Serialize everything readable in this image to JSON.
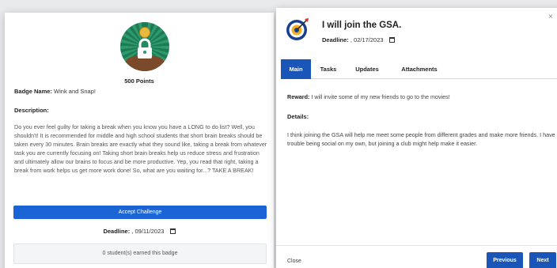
{
  "badge": {
    "points": "500 Points",
    "name_label": "Badge Name:",
    "name_value": "Wink and Snap!",
    "description_label": "Description:",
    "description": "Do you ever feel guilty for taking a break when you know you have a LONG to do list? Well, you shouldn't! It is recommended for middle and high school students that short brain breaks should be taken every 30 minutes. Brain breaks are exactly what they sound like, taking a break from whatever task you are currently focusing on! Taking short brain breaks help us reduce stress and frustration and ultimately allow our brains to focus and be more productive. Yep, you read that right, taking a break from work helps us get more work done! So, what are you waiting for...? TAKE A BREAK!",
    "accept_label": "Accept Challenge",
    "deadline_label": "Deadline:",
    "deadline_value": ", 09/11/2023",
    "earned_text": "0 student(s) earned this badge",
    "icon": "lock-badge-icon",
    "colors": {
      "accent": "#1a64d6",
      "badge_green": "#2c9a6c"
    }
  },
  "challenge": {
    "title": "I will join the GSA.",
    "deadline_label": "Deadline:",
    "deadline_value": ", 02/17/2023",
    "close_symbol": "×",
    "tabs": [
      {
        "label": "Main",
        "active": true
      },
      {
        "label": "Tasks",
        "active": false
      },
      {
        "label": "Updates",
        "active": false
      },
      {
        "label": "Attachments",
        "active": false
      }
    ],
    "reward_label": "Reward:",
    "reward_value": "I will invite some of my new friends to go to the movies!",
    "details_label": "Details:",
    "details": "I think joining the GSA will help me meet some people from different grades and make more friends. I have trouble being social on my own, but joining a club might help make it easier.",
    "footer": {
      "close_label": "Close",
      "previous_label": "Previous",
      "next_label": "Next"
    },
    "icon": "target-icon",
    "colors": {
      "accent": "#1a56b8"
    }
  }
}
